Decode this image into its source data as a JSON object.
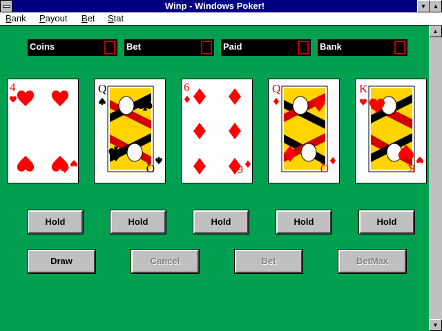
{
  "window": {
    "title": "Winp - Windows Poker!"
  },
  "menu": {
    "items": [
      "Bank",
      "Payout",
      "Bet",
      "Stat"
    ]
  },
  "meters": [
    {
      "label": "Coins",
      "value": "0"
    },
    {
      "label": "Bet",
      "value": "0"
    },
    {
      "label": "Paid",
      "value": "0"
    },
    {
      "label": "Bank",
      "value": "0"
    }
  ],
  "cards": [
    {
      "rank": "4",
      "suit": "heart",
      "color": "#ff0000"
    },
    {
      "rank": "Q",
      "suit": "spade",
      "color": "#000000"
    },
    {
      "rank": "6",
      "suit": "diamond",
      "color": "#ff0000"
    },
    {
      "rank": "Q",
      "suit": "diamond",
      "color": "#ff0000"
    },
    {
      "rank": "K",
      "suit": "heart",
      "color": "#ff0000"
    }
  ],
  "hold_label": "Hold",
  "actions": {
    "draw": "Draw",
    "cancel": "Cancel",
    "bet": "Bet",
    "betmax": "BetMax"
  },
  "colors": {
    "felt": "#00a050",
    "titlebar": "#000080",
    "digit": "#c00000"
  }
}
